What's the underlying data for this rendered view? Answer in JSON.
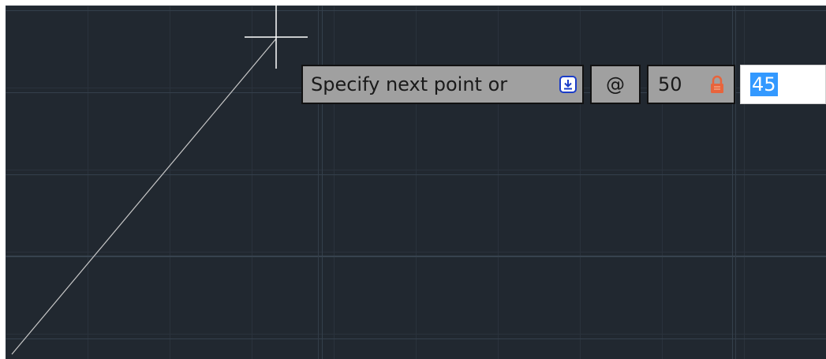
{
  "prompt": {
    "text": "Specify next point or",
    "dropdown_icon": "arrow-down-square-icon"
  },
  "relative_marker": "@",
  "length_field": {
    "value": "50",
    "lock_icon": "lock-icon"
  },
  "angle_field": {
    "value": "45"
  },
  "colors": {
    "canvas_background": "#212830",
    "grid_line": "#2a323c",
    "drawn_line": "#c8c8c8",
    "crosshair": "#ffffff",
    "input_background": "#a0a0a0",
    "selection_highlight": "#3399ff",
    "lock_color": "#e8643c",
    "dropdown_icon_color": "#1a3cc8"
  }
}
